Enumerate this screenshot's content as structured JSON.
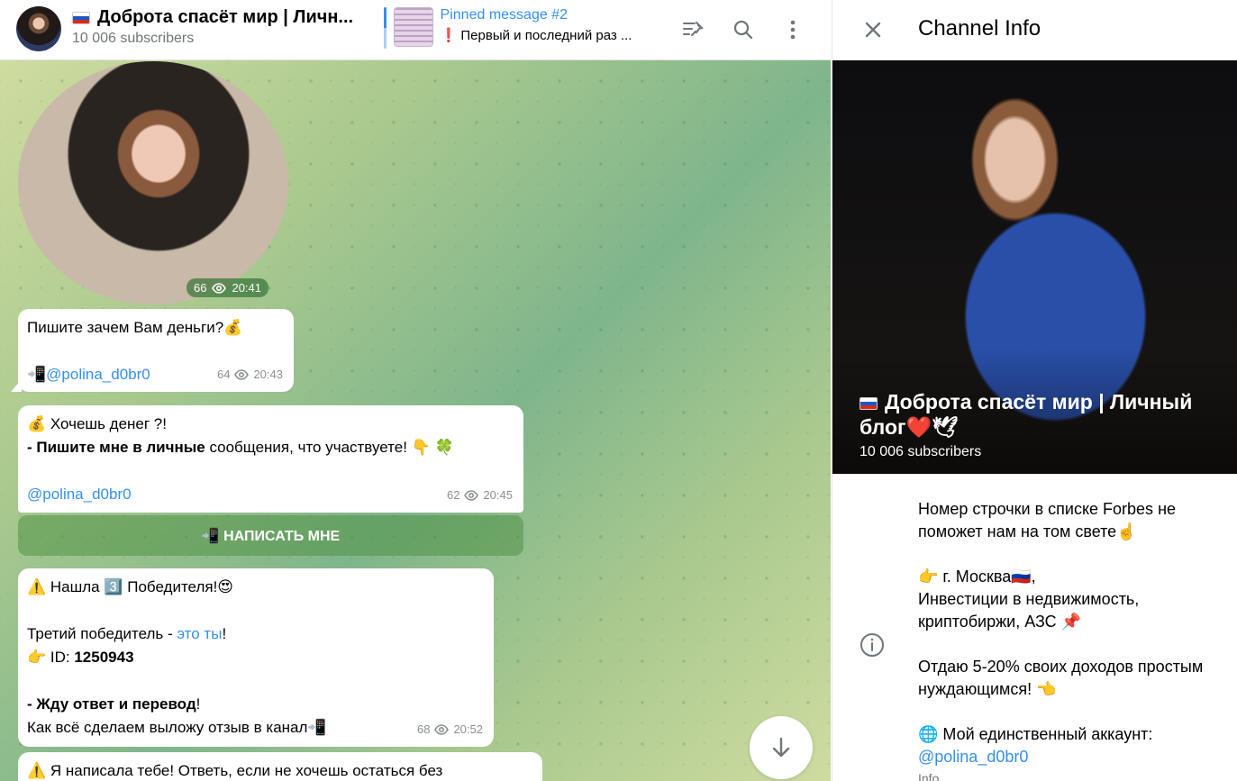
{
  "header": {
    "title": "Доброта спасёт мир | Личн...",
    "subscribers": "10 006 subscribers",
    "pinned_title": "Pinned message #2",
    "pinned_text": "❗ Первый и последний раз ..."
  },
  "messages": {
    "video": {
      "views": "66",
      "time": "20:41"
    },
    "m1": {
      "line1": "Пишите зачем Вам деньги?💰",
      "handle": "📲@polina_d0br0",
      "views": "64",
      "time": "20:43"
    },
    "m2": {
      "line1": "💰 Хочешь денег ?!",
      "line2_bold": "- Пишите мне в личные",
      "line2_rest": " сообщения, что участвуете! 👇 🍀",
      "handle": "@polina_d0br0",
      "views": "62",
      "time": "20:45"
    },
    "button_label": "📲 НАПИСАТЬ МНЕ",
    "m3": {
      "line1": "⚠️ Нашла 3️⃣ Победителя!😍",
      "line2_pre": "Третий победитель - ",
      "line2_link": "это ты",
      "line2_post": "!",
      "line3_pre": "👉 ID:  ",
      "line3_id": "1250943",
      "line4_bold": "- Жду ответ и перевод",
      "line4_rest": "!",
      "line5": "Как всё сделаем выложу отзыв в канал📲",
      "views": "68",
      "time": "20:52"
    },
    "m4": {
      "line1": "⚠️ Я написала тебе! Ответь, если не хочешь остаться без"
    }
  },
  "info": {
    "panel_title": "Channel Info",
    "channel_title": "Доброта спасёт мир | Личный блог❤️🕊",
    "subscribers": "10 006 subscribers",
    "desc_p1": "Номер строчки в списке Forbes не поможет нам на том свете☝️",
    "desc_p2_l1": "👉 г. Москва🇷🇺,",
    "desc_p2_l2": "Инвестиции в недвижимость,",
    "desc_p2_l3": "криптобиржи, АЗС 📌",
    "desc_p3": "Отдаю 5-20% своих доходов простым нуждающимся! 👈",
    "desc_p4_l1": "🌐 Мой единственный аккаунт:",
    "desc_p4_handle": "@polina_d0br0",
    "desc_label": "Info"
  },
  "colors": {
    "accent": "#3390ec",
    "secondary_text": "#707579"
  },
  "icons": [
    "unpin-icon",
    "search-icon",
    "more-vertical-icon",
    "close-icon",
    "info-icon",
    "arrow-down-icon",
    "eye-icon"
  ]
}
